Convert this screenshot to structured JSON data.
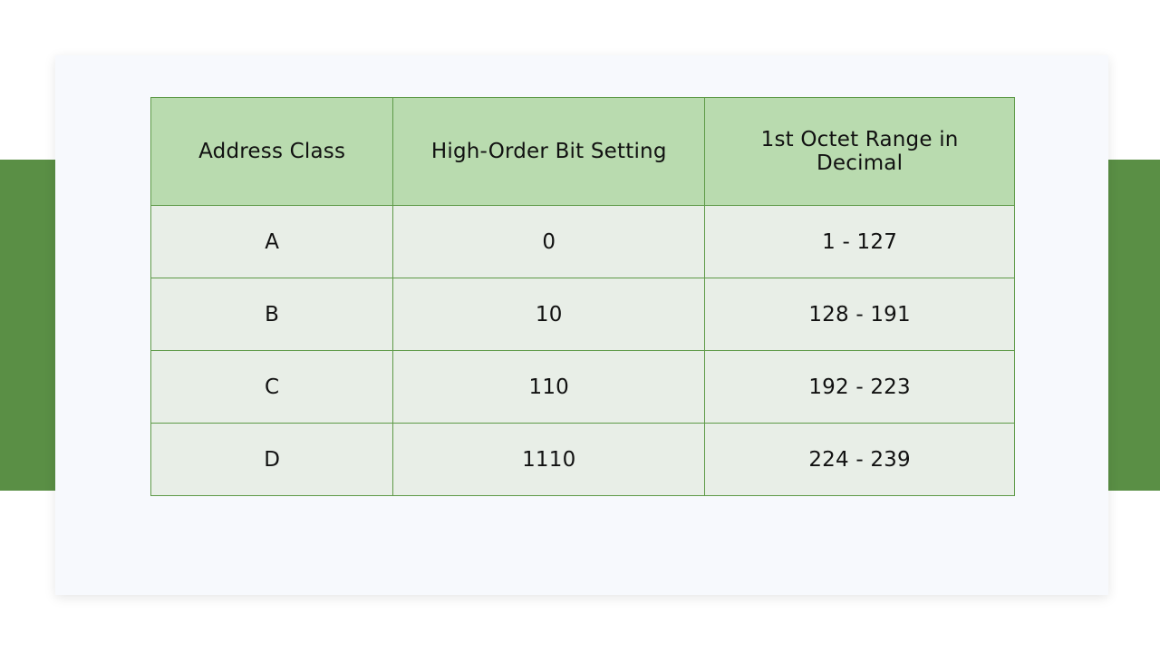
{
  "table": {
    "headers": [
      "Address Class",
      "High-Order Bit Setting",
      "1st Octet Range in Decimal"
    ],
    "rows": [
      [
        "A",
        "0",
        "1 - 127"
      ],
      [
        "B",
        "10",
        "128 - 191"
      ],
      [
        "C",
        "110",
        "192 - 223"
      ],
      [
        "D",
        "1110",
        "224 - 239"
      ]
    ]
  },
  "colors": {
    "band": "#5a8f45",
    "header_fill": "#b9dbaf",
    "row_fill": "#e8eee7",
    "border": "#5e9a48"
  }
}
